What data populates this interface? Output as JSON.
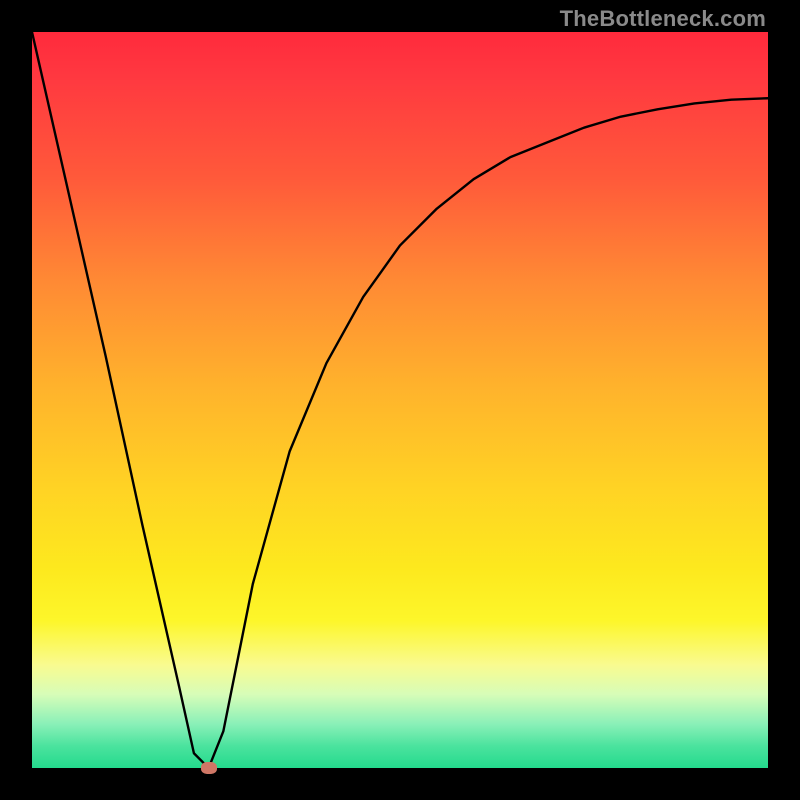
{
  "watermark": "TheBottleneck.com",
  "chart_data": {
    "type": "line",
    "title": "",
    "xlabel": "",
    "ylabel": "",
    "xlim": [
      0,
      100
    ],
    "ylim": [
      0,
      100
    ],
    "grid": false,
    "legend": false,
    "background": {
      "type": "vertical-gradient",
      "stops": [
        {
          "pos": 0,
          "color": "#ff2a3c"
        },
        {
          "pos": 20,
          "color": "#ff5a3a"
        },
        {
          "pos": 48,
          "color": "#ffb22c"
        },
        {
          "pos": 73,
          "color": "#fde91e"
        },
        {
          "pos": 90,
          "color": "#d7fdb8"
        },
        {
          "pos": 100,
          "color": "#24da8d"
        }
      ]
    },
    "series": [
      {
        "name": "bottleneck-curve",
        "color": "#000000",
        "x": [
          0,
          5,
          10,
          15,
          20,
          22,
          24,
          26,
          28,
          30,
          35,
          40,
          45,
          50,
          55,
          60,
          65,
          70,
          75,
          80,
          85,
          90,
          95,
          100
        ],
        "values": [
          100,
          78,
          56,
          33,
          11,
          2,
          0,
          5,
          15,
          25,
          43,
          55,
          64,
          71,
          76,
          80,
          83,
          85,
          87,
          88.5,
          89.5,
          90.3,
          90.8,
          91
        ]
      }
    ],
    "marker": {
      "name": "optimal-point",
      "x": 24,
      "y": 0,
      "color": "#cf7766"
    }
  }
}
